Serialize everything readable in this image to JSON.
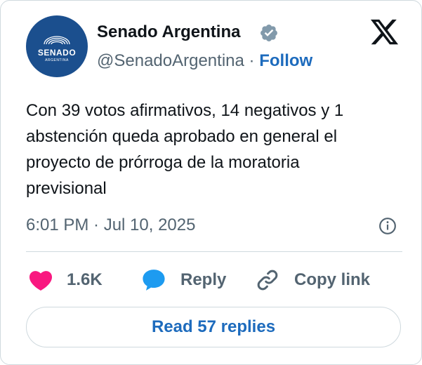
{
  "author": {
    "name": "Senado Argentina",
    "handle": "@SenadoArgentina",
    "separator": "·",
    "follow_label": "Follow",
    "avatar_text": "SENADO",
    "avatar_subtext": "ARGENTINA",
    "verified_icon": "verified-badge-icon",
    "brand_color": "#1b4f8e"
  },
  "platform_icon": "x-logo-icon",
  "tweet": {
    "lines": [
      "Con 39 votos afirmativos, 14 negativos y 1",
      "abstención queda aprobado en general el",
      "proyecto de prórroga de la moratoria",
      "previsional"
    ],
    "timestamp": "6:01 PM · Jul 10, 2025",
    "info_icon": "info-icon"
  },
  "actions": {
    "like": {
      "count": "1.6K",
      "icon": "heart-icon",
      "color": "#f91880"
    },
    "reply": {
      "label": "Reply",
      "icon": "speech-bubble-icon",
      "color": "#1d9bf0"
    },
    "copy": {
      "label": "Copy link",
      "icon": "link-icon"
    }
  },
  "read_replies_label": "Read 57 replies",
  "accent_color": "#1d6bbd"
}
